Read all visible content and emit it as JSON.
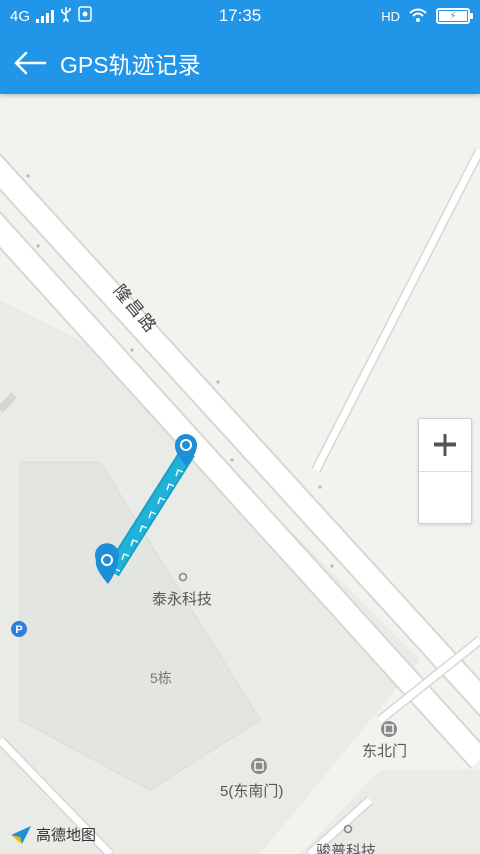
{
  "status_bar": {
    "network": "4G",
    "time": "17:35",
    "hd": "HD",
    "icons": [
      "signal-icon",
      "usb-icon",
      "notification-icon",
      "wifi-icon",
      "battery-icon"
    ]
  },
  "app_bar": {
    "title": "GPS轨迹记录",
    "back_icon": "arrow-left-icon"
  },
  "map": {
    "road_name": "隆昌路",
    "poi": {
      "company": "泰永科技",
      "building": "5栋",
      "northeast_gate": "东北门",
      "southeast_gate": "5(东南门)",
      "bottom_company": "骏普科技"
    },
    "zoom": {
      "in_symbol": "+",
      "out_symbol": "−"
    },
    "provider": "高德地图",
    "colors": {
      "track": "#1fb3d9",
      "marker": "#1d8fd6",
      "road": "#ffffff",
      "land": "#f2f2ef",
      "block": "#e9ebe6"
    }
  }
}
